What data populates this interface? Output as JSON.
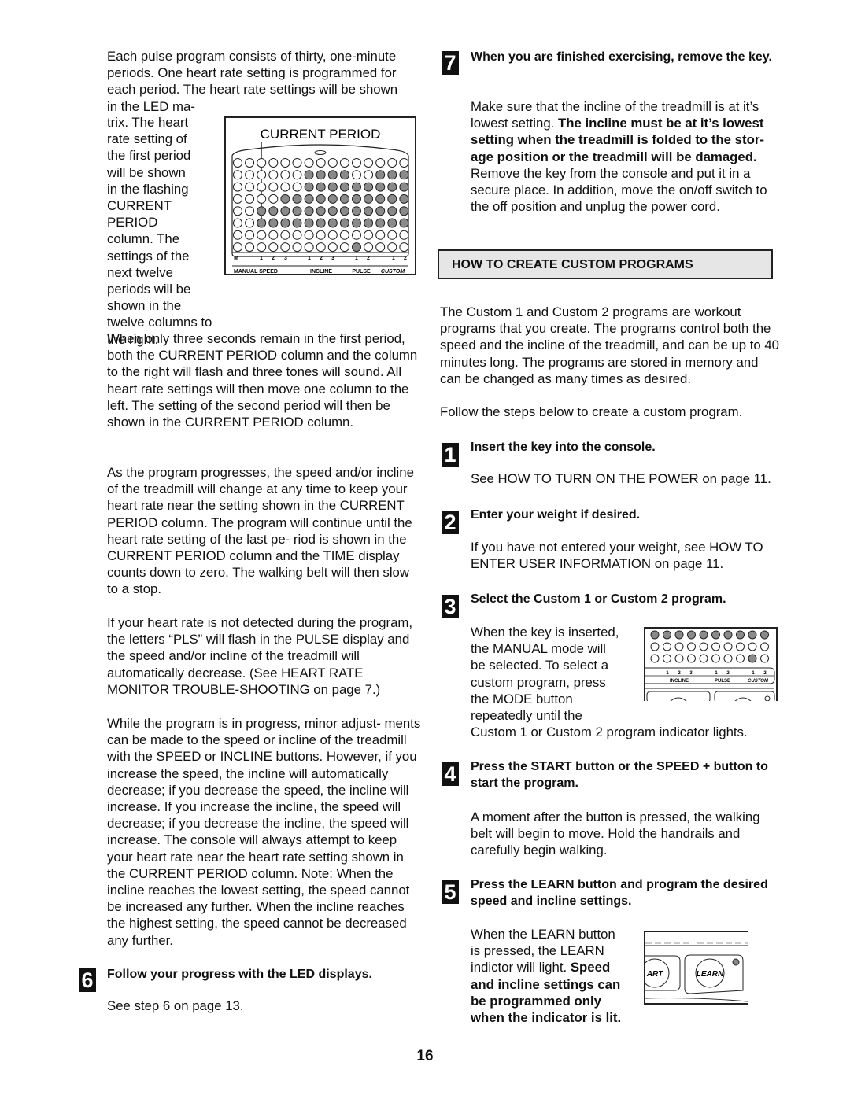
{
  "left": {
    "intro_lines": [
      "Each pulse program consists of thirty, one-minute",
      "periods. One heart rate setting is programmed for",
      "each period. The heart rate settings will be shown",
      "in the LED ma-"
    ],
    "wrap_lines": [
      "trix. The heart",
      "rate setting of",
      "the first period",
      "will be shown",
      "in the flashing",
      "CURRENT",
      "PERIOD",
      "column. The",
      "settings of the",
      "next twelve",
      "periods will be"
    ],
    "wrap_end": "shown in the twelve columns to the right.",
    "para2": "When only three seconds remain in the first period, both the CURRENT PERIOD column and the column to the right will flash and three tones will sound. All heart rate settings will then move one column to the left. The setting of the second period will then be shown in the CURRENT PERIOD column.",
    "para3": "As the program progresses, the speed and/or incline of the treadmill will change at any time to keep your heart rate near the setting shown in the CURRENT PERIOD column. The program will continue until the heart rate setting of the last pe- riod is shown in the CURRENT PERIOD column and the TIME display counts down to zero. The walking belt will then slow to a stop.",
    "para4": "If your heart rate is not detected during the program, the letters “PLS” will flash in the PULSE display and the speed and/or incline of the treadmill will automatically decrease. (See HEART RATE MONITOR TROUBLE-SHOOTING on page 7.)",
    "para5": "While the program is in progress, minor adjust- ments can be made to the speed or incline of the treadmill with the SPEED or INCLINE buttons. However, if you increase the speed, the incline will automatically decrease; if you decrease the speed, the incline will increase. If you increase the incline, the speed will decrease; if you decrease the incline, the speed will increase. The console will always attempt to keep your heart rate near the heart rate setting shown in the CURRENT PERIOD column. Note: When the incline reaches the lowest setting, the speed cannot be increased any further. When the incline reaches the highest setting, the speed cannot be decreased any further.",
    "step6": {
      "number": "6",
      "heading": "Follow your progress with the LED displays.",
      "body": "See step 6 on page 13."
    }
  },
  "led_figure": {
    "title": "CURRENT PERIOD",
    "rows": [
      "000000000000000",
      "000000111100111",
      "000000111111111",
      "000011111111111",
      "001111111111111",
      "001111111111111",
      "000000000000000",
      "000000000010000"
    ],
    "number_labels": [
      "M",
      "1",
      "2",
      "3",
      "1",
      "2",
      "3",
      "1",
      "2",
      "1",
      "2"
    ],
    "group_labels": [
      "MANUAL SPEED",
      "INCLINE",
      "PULSE",
      "CUSTOM"
    ]
  },
  "right": {
    "step7": {
      "number": "7",
      "heading": "When you are finished exercising, remove the key.",
      "body_normal_1": "Make sure that the incline of the treadmill is at it’s lowest setting. ",
      "body_bold": "The incline must be at it’s lowest setting when the treadmill is folded to the stor- age position or the treadmill will be damaged.",
      "body_normal_2": " Remove the key from the console and put it in a secure place. In addition, move the on/off switch to the off position and unplug the power cord."
    },
    "section_title": "HOW TO CREATE CUSTOM PROGRAMS",
    "intro": "The Custom 1 and Custom 2 programs are workout programs that you create. The programs control both the speed and the incline of the treadmill, and can be up to 40 minutes long. The programs are stored in memory and can be changed as many times as desired.",
    "intro2": "Follow the steps below to create a custom program.",
    "steps": [
      {
        "number": "1",
        "heading": "Insert the key into the console.",
        "body": "See HOW TO TURN ON THE POWER on page 11."
      },
      {
        "number": "2",
        "heading": "Enter your weight if desired.",
        "body": "If you have not entered your weight, see HOW TO ENTER USER INFORMATION on page 11."
      },
      {
        "number": "3",
        "heading": "Select the Custom 1 or Custom 2 program.",
        "body_lines": [
          "When the key is inserted,",
          "the MANUAL mode will",
          "be selected. To select a",
          "custom program, press",
          "the MODE button",
          "repeatedly until the"
        ],
        "body_end": "Custom 1 or Custom 2 program indicator lights."
      },
      {
        "number": "4",
        "heading": "Press the START button or the SPEED + button to start the program.",
        "body": "A moment after the button is pressed, the walking belt will begin to move. Hold the handrails and carefully begin walking."
      },
      {
        "number": "5",
        "heading": "Press the LEARN button and program the desired speed and incline settings.",
        "body_lines": [
          "When the LEARN button",
          "is pressed, the LEARN",
          "indictor will light. "
        ],
        "body_bold_lines": [
          "Speed",
          "and incline settings can",
          "be programmed only",
          "when the indicator is lit."
        ]
      }
    ]
  },
  "small_led": {
    "rows": [
      "1111111111",
      "0000000000",
      "0000000010"
    ],
    "number_labels": [
      "1",
      "2",
      "3",
      "1",
      "2",
      "1",
      "2"
    ],
    "group_labels": [
      "INCLINE",
      "PULSE",
      "CUSTOM"
    ]
  },
  "learn_figure": {
    "start_label": "ART",
    "learn_label": "LEARN"
  },
  "page_number": "16"
}
